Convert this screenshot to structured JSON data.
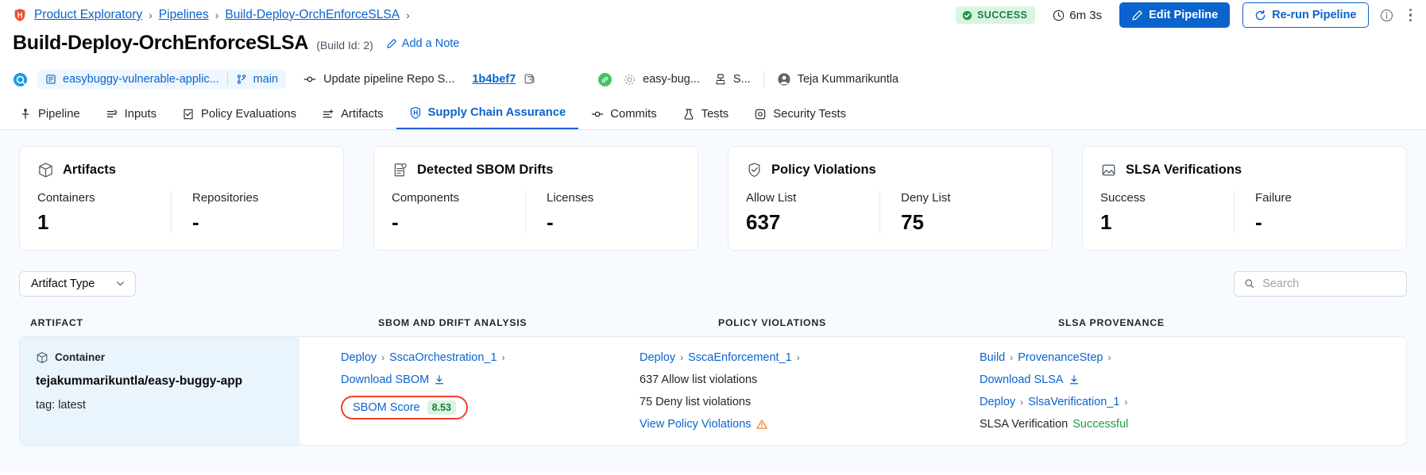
{
  "breadcrumb": {
    "logo_icon": "harness-logo-icon",
    "items": [
      "Product Exploratory",
      "Pipelines",
      "Build-Deploy-OrchEnforceSLSA"
    ],
    "separator": "›",
    "trailing_separator": "›"
  },
  "header": {
    "status": {
      "label": "SUCCESS",
      "icon": "check-circle-icon",
      "color": "#1a7f42",
      "bg": "#d9f5e2"
    },
    "duration": {
      "value": "6m 3s",
      "icon": "clock-icon"
    },
    "edit_button": {
      "label": "Edit Pipeline",
      "icon": "pencil-icon",
      "color": "#0b63ce"
    },
    "rerun_button": {
      "label": "Re-run Pipeline",
      "icon": "refresh-icon",
      "color": "#0b63ce"
    },
    "info_icon": "info-circle-icon",
    "more_icon": "kebab-menu-icon"
  },
  "title": {
    "text": "Build-Deploy-OrchEnforceSLSA",
    "build_id": "(Build Id: 2)",
    "add_note": "Add a Note",
    "add_note_icon": "pencil-icon"
  },
  "meta": {
    "provider_icon": "git-provider-icon",
    "repo": "easybuggy-vulnerable-applic...",
    "repo_icon": "repository-icon",
    "branch": "main",
    "branch_icon": "branch-icon",
    "commit_message": "Update pipeline Repo S...",
    "commit_icon": "commit-icon",
    "commit_sha": "1b4bef7",
    "copy_icon": "copy-icon",
    "trigger_status_icon": "link-success-icon",
    "service_icon": "gear-icon",
    "service": "easy-bug...",
    "env_icon": "environment-icon",
    "environment": "S...",
    "user_icon": "user-avatar-icon",
    "user": "Teja Kummarikuntla"
  },
  "tabs": [
    {
      "label": "Pipeline",
      "icon": "pipeline-icon",
      "active": false
    },
    {
      "label": "Inputs",
      "icon": "inputs-icon",
      "active": false
    },
    {
      "label": "Policy Evaluations",
      "icon": "policy-icon",
      "active": false
    },
    {
      "label": "Artifacts",
      "icon": "artifacts-icon",
      "active": false
    },
    {
      "label": "Supply Chain Assurance",
      "icon": "shield-icon",
      "active": true
    },
    {
      "label": "Commits",
      "icon": "commit-icon",
      "active": false
    },
    {
      "label": "Tests",
      "icon": "tests-icon",
      "active": false
    },
    {
      "label": "Security Tests",
      "icon": "security-icon",
      "active": false
    }
  ],
  "cards": [
    {
      "title": "Artifacts",
      "icon": "package-icon",
      "stats": [
        {
          "label": "Containers",
          "value": "1"
        },
        {
          "label": "Repositories",
          "value": "-"
        }
      ]
    },
    {
      "title": "Detected SBOM Drifts",
      "icon": "document-drift-icon",
      "stats": [
        {
          "label": "Components",
          "value": "-"
        },
        {
          "label": "Licenses",
          "value": "-"
        }
      ]
    },
    {
      "title": "Policy Violations",
      "icon": "shield-check-icon",
      "stats": [
        {
          "label": "Allow List",
          "value": "637"
        },
        {
          "label": "Deny List",
          "value": "75"
        }
      ]
    },
    {
      "title": "SLSA Verifications",
      "icon": "slsa-icon",
      "stats": [
        {
          "label": "Success",
          "value": "1"
        },
        {
          "label": "Failure",
          "value": "-"
        }
      ]
    }
  ],
  "filters": {
    "artifact_type": {
      "label": "Artifact Type",
      "chevron_icon": "chevron-down-icon"
    },
    "search": {
      "placeholder": "Search",
      "value": "",
      "icon": "search-icon"
    }
  },
  "table": {
    "headers": [
      "ARTIFACT",
      "SBOM AND DRIFT ANALYSIS",
      "POLICY VIOLATIONS",
      "SLSA PROVENANCE"
    ],
    "row": {
      "artifact": {
        "type": "Container",
        "type_icon": "package-icon",
        "name": "tejakummarikuntla/easy-buggy-app",
        "tag": "tag: latest"
      },
      "sbom": {
        "path_stage": "Deploy",
        "path_step": "SscaOrchestration_1",
        "download_label": "Download SBOM",
        "download_icon": "download-icon",
        "score_label": "SBOM Score",
        "score_value": "8.53",
        "highlight_color": "#f2402c"
      },
      "policy": {
        "path_stage": "Deploy",
        "path_step": "SscaEnforcement_1",
        "allow_violations": "637 Allow list violations",
        "deny_violations": "75 Deny list violations",
        "view_label": "View Policy Violations",
        "warning_icon": "warning-triangle-icon"
      },
      "slsa": {
        "build_stage": "Build",
        "build_step": "ProvenanceStep",
        "download_label": "Download SLSA",
        "download_icon": "download-icon",
        "verify_stage": "Deploy",
        "verify_step": "SlsaVerification_1",
        "verification_text": "SLSA Verification",
        "verification_status": "Successful",
        "status_color": "#1a9e4b"
      }
    }
  }
}
